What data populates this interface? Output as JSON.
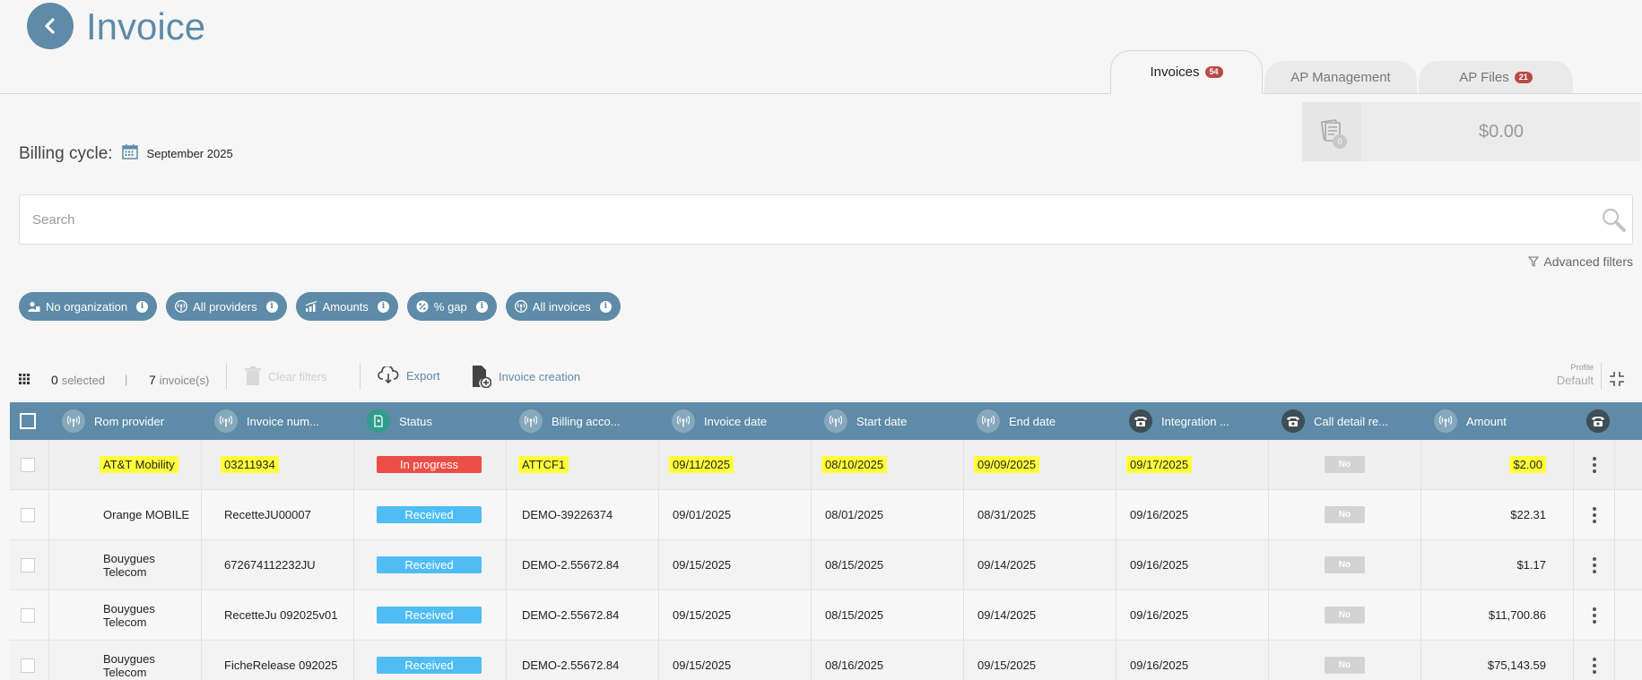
{
  "page": {
    "title": "Invoice"
  },
  "tabs": [
    {
      "label": "Invoices",
      "badge": "54"
    },
    {
      "label": "AP Management",
      "badge": ""
    },
    {
      "label": "AP Files",
      "badge": "21"
    }
  ],
  "summary": {
    "count": "0",
    "total": "$0.00"
  },
  "billing": {
    "label": "Billing cycle:",
    "value": "September 2025"
  },
  "search": {
    "placeholder": "Search",
    "value": ""
  },
  "advanced_filters": "Advanced filters",
  "filters": [
    {
      "label": "No organization",
      "icon": "org-icon"
    },
    {
      "label": "All providers",
      "icon": "antenna-icon"
    },
    {
      "label": "Amounts",
      "icon": "chart-icon"
    },
    {
      "label": "% gap",
      "icon": "percent-icon"
    },
    {
      "label": "All invoices",
      "icon": "antenna-icon"
    }
  ],
  "toolbar": {
    "selected_count": "0",
    "selected_label": "selected",
    "separator": "|",
    "invoice_count": "7",
    "invoice_label": "invoice(s)",
    "clear_filters": "Clear filters",
    "export": "Export",
    "invoice_creation": "Invoice creation",
    "profile_label": "Profile",
    "profile_value": "Default"
  },
  "columns": [
    "Rom provider",
    "Invoice num...",
    "Status",
    "Billing acco...",
    "Invoice date",
    "Start date",
    "End date",
    "Integration ...",
    "Call detail re...",
    "Amount"
  ],
  "rows": [
    {
      "provider": "AT&T Mobility",
      "invoice_number": "03211934",
      "status": "In progress",
      "billing_account": "ATTCF1",
      "invoice_date": "09/11/2025",
      "start_date": "08/10/2025",
      "end_date": "09/09/2025",
      "integration": "09/17/2025",
      "cdr": "No",
      "amount": "$2.00"
    },
    {
      "provider": "Orange MOBILE",
      "invoice_number": "RecetteJU00007",
      "status": "Received",
      "billing_account": "DEMO-39226374",
      "invoice_date": "09/01/2025",
      "start_date": "08/01/2025",
      "end_date": "08/31/2025",
      "integration": "09/16/2025",
      "cdr": "No",
      "amount": "$22.31"
    },
    {
      "provider": "Bouygues Telecom",
      "invoice_number": "672674112232JU",
      "status": "Received",
      "billing_account": "DEMO-2.55672.84",
      "invoice_date": "09/15/2025",
      "start_date": "08/15/2025",
      "end_date": "09/14/2025",
      "integration": "09/16/2025",
      "cdr": "No",
      "amount": "$1.17"
    },
    {
      "provider": "Bouygues Telecom",
      "invoice_number": "RecetteJu 092025v01",
      "status": "Received",
      "billing_account": "DEMO-2.55672.84",
      "invoice_date": "09/15/2025",
      "start_date": "08/15/2025",
      "end_date": "09/14/2025",
      "integration": "09/16/2025",
      "cdr": "No",
      "amount": "$11,700.86"
    },
    {
      "provider": "Bouygues Telecom",
      "invoice_number": "FicheRelease 092025",
      "status": "Received",
      "billing_account": "DEMO-2.55672.84",
      "invoice_date": "09/15/2025",
      "start_date": "08/16/2025",
      "end_date": "09/15/2025",
      "integration": "09/16/2025",
      "cdr": "No",
      "amount": "$75,143.59"
    }
  ],
  "colors": {
    "accent": "#5e8ba7",
    "in_progress": "#ea4e46",
    "received": "#4fbdf4",
    "highlight": "#ffff3a",
    "badge": "#b94a48"
  }
}
